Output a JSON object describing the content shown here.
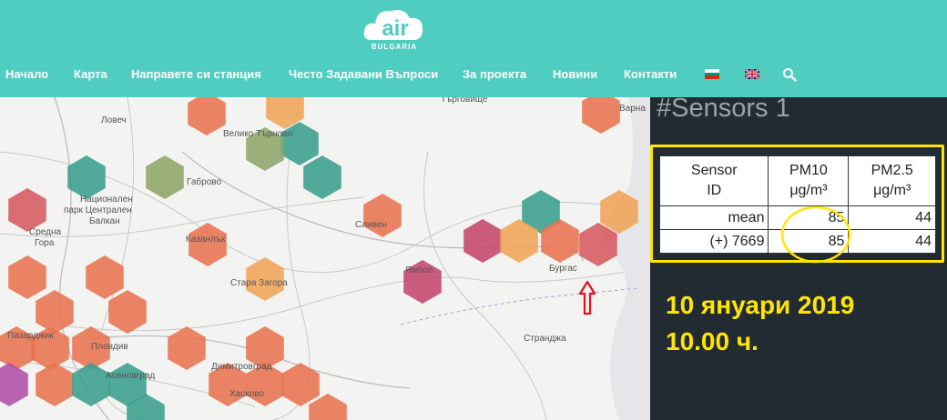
{
  "header": {
    "logo_text": "air",
    "logo_subtitle": "BULGARIA",
    "nav": [
      {
        "label": "Начало"
      },
      {
        "label": "Карта"
      },
      {
        "label": "Направете си станция"
      },
      {
        "label": "Често Задавани Въпроси"
      },
      {
        "label": "За проекта"
      },
      {
        "label": "Новини"
      },
      {
        "label": "Контакти"
      }
    ],
    "languages": [
      "bulgarian-flag-icon",
      "uk-flag-icon"
    ],
    "search_icon": "search-icon",
    "colors": {
      "header_bg": "#4fcdc0",
      "text": "#ffffff"
    }
  },
  "map": {
    "city_labels": [
      "Ловеч",
      "Велико Търново",
      "Габрово",
      "Национален",
      "парк Централен",
      "Балкан",
      "Средна",
      "Гора",
      "Сливен",
      "Казанлък",
      "Ямбол",
      "Бургас",
      "Стара Загора",
      "Пазарджик",
      "Пловдив",
      "Асеновград",
      "Димитровград",
      "Хасково",
      "Странджа",
      "Варна",
      "Търговище"
    ],
    "marker_icon": "red-up-arrow-icon"
  },
  "panel": {
    "title": "#Sensors 1",
    "table": {
      "headers": [
        "Sensor\nID",
        "PM10\nμg/m³",
        "PM2.5\nμg/m³"
      ],
      "rows": [
        [
          "mean",
          "85",
          "44"
        ],
        [
          "(+) 7669",
          "85",
          "44"
        ]
      ]
    },
    "annotation_date": "10 януари 2019",
    "annotation_time": "10.00 ч.",
    "colors": {
      "panel_bg": "#222b31",
      "highlight": "#ffe600"
    }
  }
}
